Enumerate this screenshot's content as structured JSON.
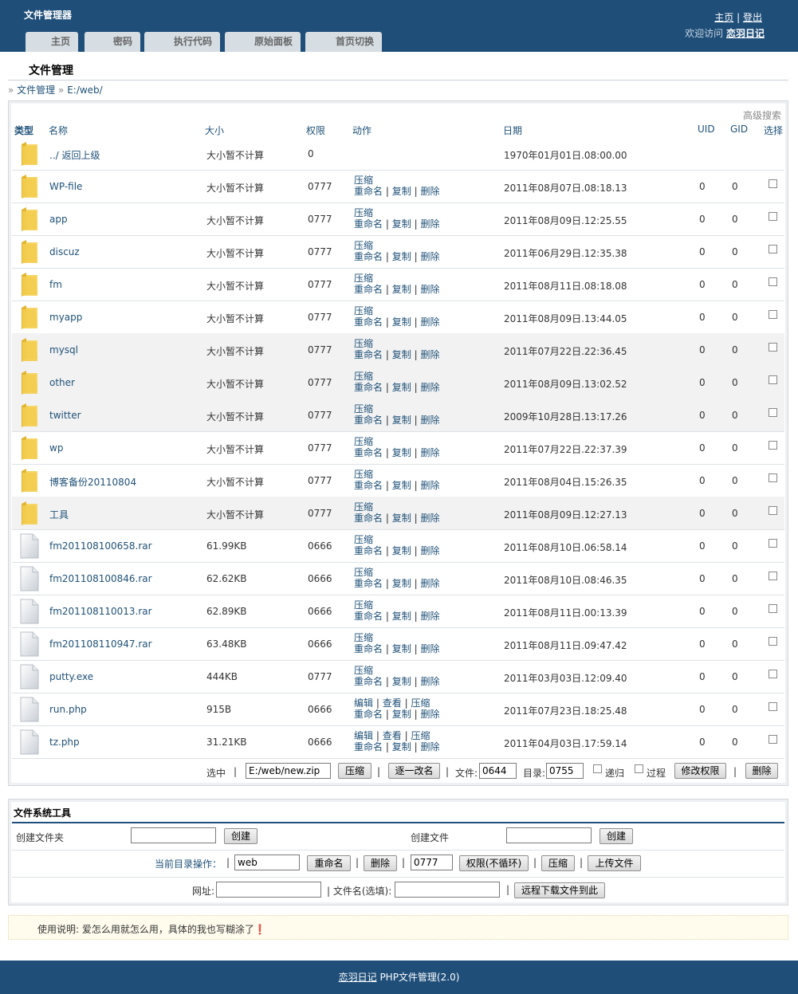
{
  "header": {
    "app_title": "文件管理器",
    "links": {
      "home": "主页",
      "logout": "登出",
      "sep": "|"
    },
    "welcome_prefix": "欢迎访问",
    "site_name": "恋羽日记"
  },
  "tabs": [
    "主页",
    "密码",
    "执行代码",
    "原始面板",
    "首页切换"
  ],
  "page": {
    "title": "文件管理",
    "breadcrumb": {
      "sep": "»",
      "root": "文件管理",
      "path": "E:/web/"
    }
  },
  "filelist": {
    "advanced_search": "高级搜索",
    "columns": {
      "type": "类型",
      "name": "名称",
      "size": "大小",
      "perm": "权限",
      "action": "动作",
      "date": "日期",
      "uid": "UID",
      "gid": "GID",
      "select": "选择"
    },
    "actions": {
      "compress": "压缩",
      "rename": "重命名",
      "copy": "复制",
      "delete": "删除",
      "edit": "编辑",
      "view": "查看",
      "sep": "|"
    },
    "rows": [
      {
        "kind": "folder",
        "name": "../ 返回上级",
        "size": "大小暂不计算",
        "perm": "0",
        "date": "1970年01月01日.08:00.00",
        "uid": "",
        "gid": "",
        "actions": "none",
        "select": false
      },
      {
        "kind": "folder",
        "name": "WP-file",
        "size": "大小暂不计算",
        "perm": "0777",
        "date": "2011年08月07日.08:18.13",
        "uid": "0",
        "gid": "0",
        "actions": "dir",
        "select": true
      },
      {
        "kind": "folder",
        "name": "app",
        "size": "大小暂不计算",
        "perm": "0777",
        "date": "2011年08月09日.12:25.55",
        "uid": "0",
        "gid": "0",
        "actions": "dir",
        "select": true
      },
      {
        "kind": "folder",
        "name": "discuz",
        "size": "大小暂不计算",
        "perm": "0777",
        "date": "2011年06月29日.12:35.38",
        "uid": "0",
        "gid": "0",
        "actions": "dir",
        "select": true
      },
      {
        "kind": "folder",
        "name": "fm",
        "size": "大小暂不计算",
        "perm": "0777",
        "date": "2011年08月11日.08:18.08",
        "uid": "0",
        "gid": "0",
        "actions": "dir",
        "select": true
      },
      {
        "kind": "folder",
        "name": "myapp",
        "size": "大小暂不计算",
        "perm": "0777",
        "date": "2011年08月09日.13:44.05",
        "uid": "0",
        "gid": "0",
        "actions": "dir",
        "select": true
      },
      {
        "kind": "folder",
        "name": "mysql",
        "size": "大小暂不计算",
        "perm": "0777",
        "date": "2011年07月22日.22:36.45",
        "uid": "0",
        "gid": "0",
        "actions": "dir",
        "select": true
      },
      {
        "kind": "folder",
        "name": "other",
        "size": "大小暂不计算",
        "perm": "0777",
        "date": "2011年08月09日.13:02.52",
        "uid": "0",
        "gid": "0",
        "actions": "dir",
        "select": true
      },
      {
        "kind": "folder",
        "name": "twitter",
        "size": "大小暂不计算",
        "perm": "0777",
        "date": "2009年10月28日.13:17.26",
        "uid": "0",
        "gid": "0",
        "actions": "dir",
        "select": true
      },
      {
        "kind": "folder",
        "name": "wp",
        "size": "大小暂不计算",
        "perm": "0777",
        "date": "2011年07月22日.22:37.39",
        "uid": "0",
        "gid": "0",
        "actions": "dir",
        "select": true
      },
      {
        "kind": "folder",
        "name": "博客备份20110804",
        "size": "大小暂不计算",
        "perm": "0777",
        "date": "2011年08月04日.15:26.35",
        "uid": "0",
        "gid": "0",
        "actions": "dir",
        "select": true
      },
      {
        "kind": "folder",
        "name": "工具",
        "size": "大小暂不计算",
        "perm": "0777",
        "date": "2011年08月09日.12:27.13",
        "uid": "0",
        "gid": "0",
        "actions": "dir",
        "select": true
      },
      {
        "kind": "file",
        "name": "fm201108100658.rar",
        "size": "61.99KB",
        "perm": "0666",
        "date": "2011年08月10日.06:58.14",
        "uid": "0",
        "gid": "0",
        "actions": "dir",
        "select": true
      },
      {
        "kind": "file",
        "name": "fm201108100846.rar",
        "size": "62.62KB",
        "perm": "0666",
        "date": "2011年08月10日.08:46.35",
        "uid": "0",
        "gid": "0",
        "actions": "dir",
        "select": true
      },
      {
        "kind": "file",
        "name": "fm201108110013.rar",
        "size": "62.89KB",
        "perm": "0666",
        "date": "2011年08月11日.00:13.39",
        "uid": "0",
        "gid": "0",
        "actions": "dir",
        "select": true
      },
      {
        "kind": "file",
        "name": "fm201108110947.rar",
        "size": "63.48KB",
        "perm": "0666",
        "date": "2011年08月11日.09:47.42",
        "uid": "0",
        "gid": "0",
        "actions": "dir",
        "select": true
      },
      {
        "kind": "file",
        "name": "putty.exe",
        "size": "444KB",
        "perm": "0777",
        "date": "2011年03月03日.12:09.40",
        "uid": "0",
        "gid": "0",
        "actions": "dir",
        "select": true
      },
      {
        "kind": "file",
        "name": "run.php",
        "size": "915B",
        "perm": "0666",
        "date": "2011年07月23日.18:25.48",
        "uid": "0",
        "gid": "0",
        "actions": "text",
        "select": true
      },
      {
        "kind": "file",
        "name": "tz.php",
        "size": "31.21KB",
        "perm": "0666",
        "date": "2011年04月03日.17:59.14",
        "uid": "0",
        "gid": "0",
        "actions": "text",
        "select": true
      }
    ],
    "batch": {
      "selected_label": "选中",
      "zip_path": "E:/web/new.zip",
      "compress_btn": "压缩",
      "rename_each_btn": "逐一改名",
      "file_label": "文件:",
      "file_perm": "0644",
      "dir_label": "目录:",
      "dir_perm": "0755",
      "recursive_label": "递归",
      "process_label": "过程",
      "chmod_btn": "修改权限",
      "delete_btn": "删除"
    }
  },
  "tools": {
    "title": "文件系统工具",
    "create_folder_label": "创建文件夹",
    "create_folder_value": "",
    "create_btn": "创建",
    "create_file_label": "创建文件",
    "create_file_value": "",
    "current_dir_label": "当前目录操作：",
    "current_dir_value": "web",
    "rename_btn": "重命名",
    "delete_btn": "删除",
    "perm_value": "0777",
    "chmod_nonrec_btn": "权限(不循环)",
    "compress_btn": "压缩",
    "upload_btn": "上传文件",
    "url_label": "网址:",
    "url_value": "",
    "filename_label": "| 文件名(选填):",
    "filename_value": "",
    "remote_download_btn": "远程下载文件到此"
  },
  "notice": "使用说明: 爱怎么用就怎么用，具体的我也写糊涂了❗",
  "footer": {
    "site_name": "恋羽日记",
    "app_version": "PHP文件管理(2.0)"
  }
}
